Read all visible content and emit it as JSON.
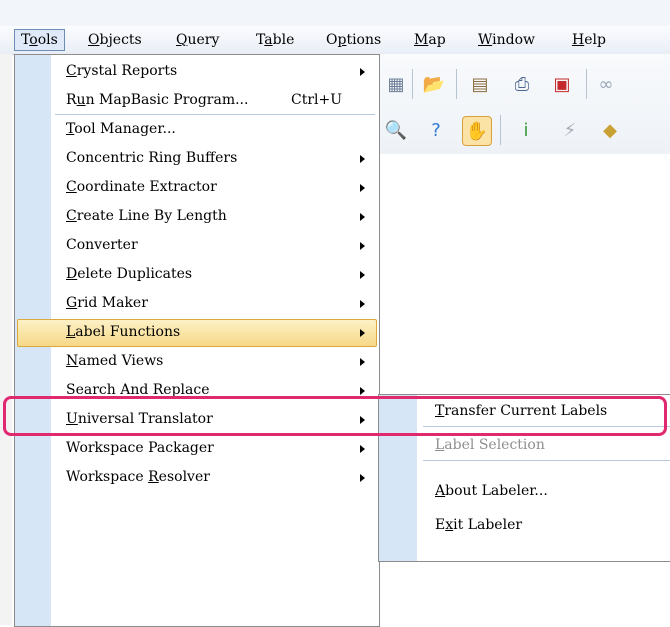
{
  "menubar": {
    "items": [
      {
        "label": "Tools",
        "mnemonic": "o"
      },
      {
        "label": "Objects",
        "mnemonic": "O"
      },
      {
        "label": "Query",
        "mnemonic": "Q"
      },
      {
        "label": "Table",
        "mnemonic": "a"
      },
      {
        "label": "Options",
        "mnemonic": "p"
      },
      {
        "label": "Map",
        "mnemonic": "M"
      },
      {
        "label": "Window",
        "mnemonic": "W"
      },
      {
        "label": "Help",
        "mnemonic": "H"
      }
    ]
  },
  "toolbar": {
    "row1": [
      {
        "icon": "table-icon",
        "glyph": "▦",
        "color": "#6d7f99"
      },
      {
        "icon": "open-folder-icon",
        "glyph": "📂",
        "color": "#d9a422"
      },
      {
        "icon": "layers-icon",
        "glyph": "▤",
        "color": "#8c6d3f"
      },
      {
        "icon": "printer-icon",
        "glyph": "⎙",
        "color": "#4d6890"
      },
      {
        "icon": "pdf-icon",
        "glyph": "▣",
        "color": "#c42a2a"
      },
      {
        "icon": "chain-icon",
        "glyph": "∞",
        "color": "#9aa5b4"
      }
    ],
    "row2": [
      {
        "icon": "zoom-out-icon",
        "glyph": "🔍",
        "color": "#4f7ec0"
      },
      {
        "icon": "help-icon",
        "glyph": "?",
        "color": "#2f7bd2"
      },
      {
        "icon": "hand-pan-icon",
        "glyph": "✋",
        "color": "#c4871d"
      },
      {
        "icon": "info-icon",
        "glyph": "i",
        "color": "#3a9a3a"
      },
      {
        "icon": "hotlink-icon",
        "glyph": "⚡",
        "color": "#a7aeb8"
      },
      {
        "icon": "label-tag-icon",
        "glyph": "◆",
        "color": "#c9a235"
      }
    ]
  },
  "tools_menu": {
    "items": [
      {
        "label": "Crystal Reports",
        "mnemonic": "C",
        "submenu": true,
        "separator_after": false
      },
      {
        "label": "Run MapBasic Program...",
        "mnemonic": "u",
        "shortcut": "Ctrl+U",
        "submenu": false,
        "separator_after": true
      },
      {
        "label": "Tool Manager...",
        "mnemonic": "T",
        "submenu": false,
        "separator_after": false
      },
      {
        "label": "Concentric Ring Buffers",
        "submenu": true,
        "separator_after": false
      },
      {
        "label": "Coordinate Extractor",
        "mnemonic": "C",
        "submenu": true,
        "separator_after": false
      },
      {
        "label": "Create Line By Length",
        "mnemonic": "C",
        "submenu": true,
        "separator_after": false
      },
      {
        "label": "Converter",
        "submenu": true,
        "separator_after": false
      },
      {
        "label": "Delete Duplicates",
        "mnemonic": "D",
        "submenu": true,
        "separator_after": false
      },
      {
        "label": "Grid Maker",
        "mnemonic": "G",
        "submenu": true,
        "separator_after": false
      },
      {
        "label": "Label Functions",
        "mnemonic": "L",
        "submenu": true,
        "separator_after": false,
        "highlighted": true
      },
      {
        "label": "Named Views",
        "mnemonic": "N",
        "submenu": true,
        "separator_after": false
      },
      {
        "label": "Search And Replace",
        "submenu": true,
        "separator_after": false
      },
      {
        "label": "Universal Translator",
        "mnemonic": "U",
        "submenu": true,
        "separator_after": false
      },
      {
        "label": "Workspace Packager",
        "submenu": true,
        "separator_after": false
      },
      {
        "label": "Workspace Resolver",
        "mnemonic": "R",
        "submenu": true,
        "separator_after": false
      }
    ]
  },
  "label_submenu": {
    "items": [
      {
        "label": "Transfer Current Labels",
        "mnemonic": "T",
        "enabled": true,
        "separator_after": true
      },
      {
        "label": "Label Selection",
        "mnemonic": "L",
        "enabled": false,
        "separator_after": true
      },
      {
        "label": "About Labeler...",
        "mnemonic": "A",
        "enabled": true,
        "separator_after": false
      },
      {
        "label": "Exit Labeler",
        "mnemonic": "x",
        "enabled": true,
        "separator_after": false
      }
    ]
  },
  "colors": {
    "highlight_border": "#e0296f",
    "menu_gutter": "#d7e6f6",
    "hover_fill": "#f6d887"
  }
}
